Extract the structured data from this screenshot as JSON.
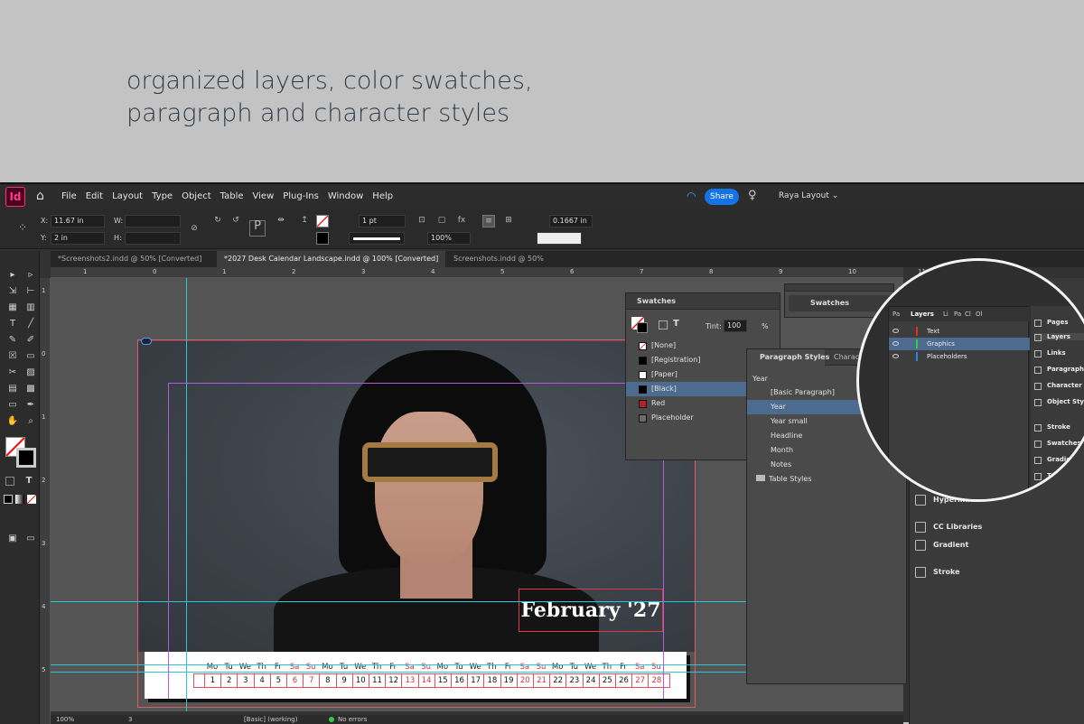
{
  "headline": {
    "line1": "organized layers, color swatches,",
    "line2": "paragraph and character styles"
  },
  "app": {
    "logo": "Id",
    "menus": [
      "File",
      "Edit",
      "Layout",
      "Type",
      "Object",
      "Table",
      "View",
      "Plug-Ins",
      "Window",
      "Help"
    ],
    "share_label": "Share",
    "workspace_label": "Raya Layout ⌄"
  },
  "control": {
    "x_label": "X:",
    "x_value": "11.67 in",
    "y_label": "Y:",
    "y_value": "2 in",
    "w_label": "W:",
    "h_label": "H:",
    "stroke_weight": "1 pt",
    "opacity": "100%",
    "offset": "0.1667 in"
  },
  "tabs": [
    {
      "label": "*Screenshots2.indd @ 50% [Converted]"
    },
    {
      "label": "*2027 Desk Calendar Landscape.indd @ 100% [Converted]"
    },
    {
      "label": "Screenshots.indd @ 50%"
    }
  ],
  "ruler_top": [
    "1",
    "0",
    "1",
    "2",
    "3",
    "4",
    "5",
    "6",
    "7",
    "8",
    "9",
    "10",
    "11"
  ],
  "ruler_left": [
    "1",
    "0",
    "1",
    "2",
    "3",
    "4",
    "5"
  ],
  "calendar": {
    "title": "February '27",
    "days": [
      "Mo",
      "Tu",
      "We",
      "Th",
      "Fr",
      "Sa",
      "Su",
      "Mo",
      "Tu",
      "We",
      "Th",
      "Fr",
      "Sa",
      "Su",
      "Mo",
      "Tu",
      "We",
      "Th",
      "Fr",
      "Sa",
      "Su",
      "Mo",
      "Tu",
      "We",
      "Th",
      "Fr",
      "Sa",
      "Su"
    ],
    "dates": [
      "1",
      "2",
      "3",
      "4",
      "5",
      "6",
      "7",
      "8",
      "9",
      "10",
      "11",
      "12",
      "13",
      "14",
      "15",
      "16",
      "17",
      "18",
      "19",
      "20",
      "21",
      "22",
      "23",
      "24",
      "25",
      "26",
      "27",
      "28"
    ],
    "weekend_color": "#d0304a"
  },
  "swatches_panel": {
    "title": "Swatches",
    "tint_label": "Tint:",
    "tint_value": "100",
    "tint_unit": "%",
    "items": [
      {
        "name": "[None]",
        "color": "none"
      },
      {
        "name": "[Registration]",
        "color": "#000000"
      },
      {
        "name": "[Paper]",
        "color": "#ffffff"
      },
      {
        "name": "[Black]",
        "color": "#000000"
      },
      {
        "name": "Red",
        "color": "#b0202f"
      },
      {
        "name": "Placeholder",
        "color": "#6b6b6b"
      }
    ]
  },
  "swatches_collapsed": {
    "title": "Swatches"
  },
  "paragraph_panel": {
    "tab1": "Paragraph Styles",
    "tab2": "Character",
    "current": "Year",
    "items": [
      "[Basic Paragraph]",
      "Year",
      "Year small",
      "Headline",
      "Month",
      "Notes",
      "Table Styles"
    ]
  },
  "dock": {
    "items": [
      "Object Styles",
      "Paragraph Styles",
      "Character Styles",
      "Hyperlinks",
      "CC Libraries",
      "Gradient",
      "Stroke"
    ]
  },
  "zoom": {
    "tabs": [
      "Pa",
      "Layers",
      "Li",
      "Pa",
      "Cl",
      "Ol"
    ],
    "layers": [
      {
        "name": "Text",
        "color": "#e03030"
      },
      {
        "name": "Graphics",
        "color": "#30d030"
      },
      {
        "name": "Placeholders",
        "color": "#3080e0"
      }
    ],
    "dock": [
      "Pages",
      "Layers",
      "Links",
      "Paragraph ...",
      "Character S...",
      "Object Styles",
      "Stroke",
      "Swatches",
      "Gradient",
      "Text ..."
    ]
  },
  "status": {
    "zoom": "100%",
    "page": "3",
    "style": "[Basic] (working)",
    "errors": "No errors"
  }
}
